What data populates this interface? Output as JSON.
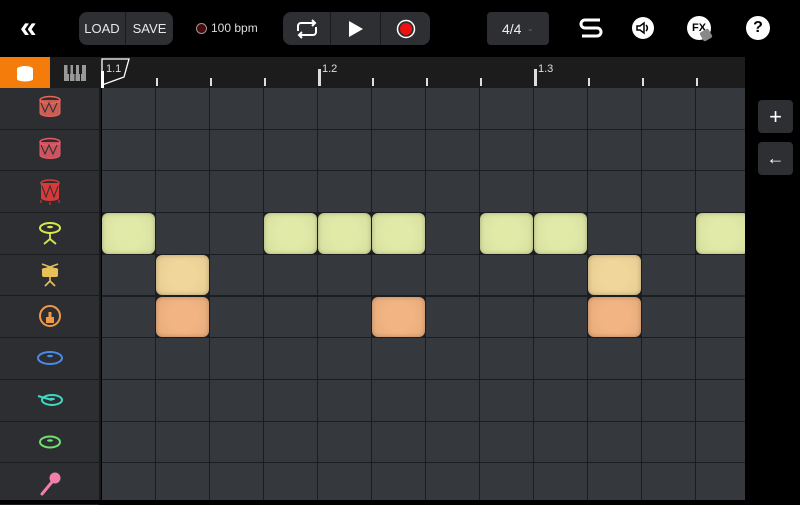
{
  "toolbar": {
    "load": "LOAD",
    "save": "SAVE",
    "tempo": "100 bpm",
    "time_signature": "4/4",
    "fx": "FX",
    "help": "?"
  },
  "tabs": {
    "drums": "drums",
    "keys": "keys"
  },
  "ruler": {
    "labels": [
      "1.1",
      "1.2",
      "1.3"
    ]
  },
  "side_buttons": {
    "add": "+",
    "back": "←"
  },
  "colors": {
    "row0": "#e8665a",
    "row1": "#e85a66",
    "row2": "#d83a3a",
    "row3": "#d8e84a",
    "row4": "#e8c05a",
    "row5": "#f09a48",
    "row6": "#4a8ae8",
    "row7": "#40d8c0",
    "row8": "#70e070",
    "row9": "#f080a8"
  },
  "instruments": [
    "drum",
    "drum",
    "floor-tom",
    "hihat",
    "snare",
    "kick",
    "cymbal",
    "ride",
    "crash",
    "microphone"
  ],
  "pattern": [
    [],
    [],
    [],
    [
      0,
      3,
      4,
      5,
      7,
      8,
      11
    ],
    [
      1,
      9
    ],
    [
      1,
      5,
      9
    ],
    [],
    [],
    [],
    []
  ],
  "pad_colors": {
    "3": "#e2eaa8",
    "4": "#f0d69a",
    "5": "#f2b482"
  }
}
